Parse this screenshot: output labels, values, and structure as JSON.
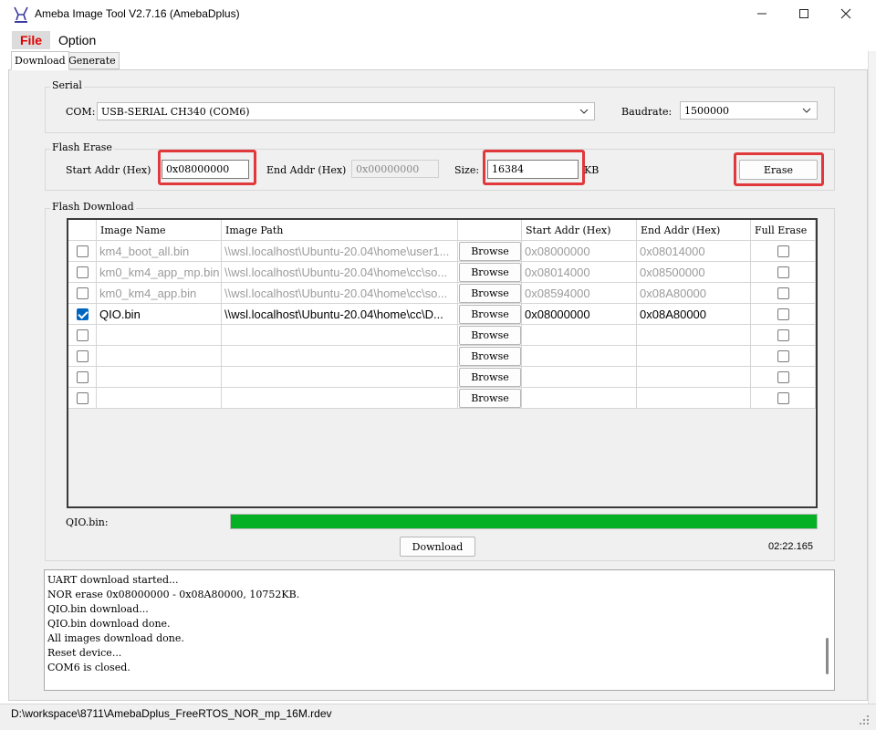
{
  "window": {
    "title": "Ameba Image Tool V2.7.16 (AmebaDplus)",
    "minimize_icon": "minimize-icon",
    "maximize_icon": "maximize-icon",
    "close_icon": "close-icon"
  },
  "menu": {
    "file": "File",
    "option": "Option"
  },
  "tabs": {
    "download": "Download",
    "generate": "Generate"
  },
  "serial": {
    "group_title": "Serial",
    "com_label": "COM:",
    "com_value": "USB-SERIAL CH340 (COM6)",
    "baud_label": "Baudrate:",
    "baud_value": "1500000"
  },
  "flash_erase": {
    "group_title": "Flash Erase",
    "start_label": "Start Addr (Hex)",
    "start_value": "0x08000000",
    "end_label": "End Addr (Hex)",
    "end_value": "0x00000000",
    "size_label": "Size:",
    "size_value": "16384",
    "size_unit": "KB",
    "erase_button": "Erase"
  },
  "flash_download": {
    "group_title": "Flash Download",
    "columns": [
      "",
      "Image Name",
      "Image Path",
      "",
      "Start Addr (Hex)",
      "End Addr (Hex)",
      "Full Erase"
    ],
    "browse_label": "Browse",
    "rows": [
      {
        "checked": false,
        "name": "km4_boot_all.bin",
        "path": "\\\\wsl.localhost\\Ubuntu-20.04\\home\\user1...",
        "start": "0x08000000",
        "end": "0x08014000",
        "full_erase": false
      },
      {
        "checked": false,
        "name": "km0_km4_app_mp.bin",
        "path": "\\\\wsl.localhost\\Ubuntu-20.04\\home\\cc\\so...",
        "start": "0x08014000",
        "end": "0x08500000",
        "full_erase": false
      },
      {
        "checked": false,
        "name": "km0_km4_app.bin",
        "path": "\\\\wsl.localhost\\Ubuntu-20.04\\home\\cc\\so...",
        "start": "0x08594000",
        "end": "0x08A80000",
        "full_erase": false
      },
      {
        "checked": true,
        "name": "QIO.bin",
        "path": "\\\\wsl.localhost\\Ubuntu-20.04\\home\\cc\\D...",
        "start": "0x08000000",
        "end": "0x08A80000",
        "full_erase": false
      },
      {
        "checked": false,
        "name": "",
        "path": "",
        "start": "",
        "end": "",
        "full_erase": false
      },
      {
        "checked": false,
        "name": "",
        "path": "",
        "start": "",
        "end": "",
        "full_erase": false
      },
      {
        "checked": false,
        "name": "",
        "path": "",
        "start": "",
        "end": "",
        "full_erase": false
      },
      {
        "checked": false,
        "name": "",
        "path": "",
        "start": "",
        "end": "",
        "full_erase": false
      }
    ]
  },
  "progress": {
    "label": "QIO.bin:",
    "fraction": 1.0,
    "color": "#06b025"
  },
  "download_button": "Download",
  "elapsed": "02:22.165",
  "log": [
    "UART download started...",
    "NOR erase 0x08000000 - 0x08A80000, 10752KB.",
    "QIO.bin download...",
    "QIO.bin download done.",
    "All images download done.",
    "Reset device...",
    "COM6 is closed."
  ],
  "status_path": "D:\\workspace\\8711\\AmebaDplus_FreeRTOS_NOR_mp_16M.rdev",
  "colors": {
    "highlight": "#e0383b",
    "menu_file": "#e00000",
    "checkbox": "#0067c0"
  }
}
